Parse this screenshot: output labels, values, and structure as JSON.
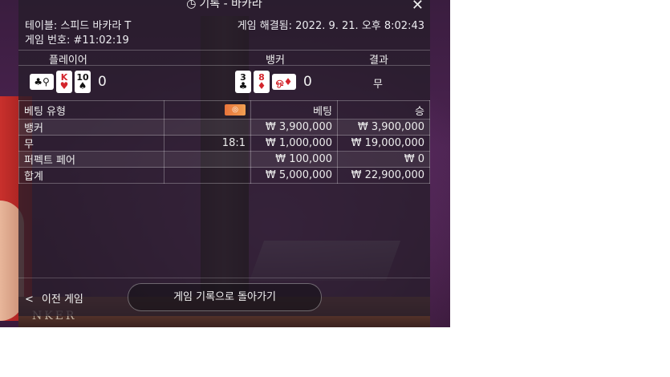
{
  "header": {
    "title": "기록 - 바카라",
    "title_icon": "history-icon",
    "close_icon": "close-icon"
  },
  "game_info": {
    "table": "테이블: 스피드 바카라 T",
    "game_number": "게임 번호: #11:02:19",
    "resolved": "게임 해결됨: 2022. 9. 21. 오후 8:02:43"
  },
  "result_headers": {
    "player": "플레이어",
    "banker": "뱅커",
    "result": "결과"
  },
  "player_hand": {
    "cards": [
      {
        "rank": "♣",
        "suit": "♣",
        "side": true,
        "color": "#111111",
        "glyph2": "⚲"
      },
      {
        "rank": "K",
        "suit": "♥",
        "color": "#d3252c"
      },
      {
        "rank": "10",
        "suit": "♠",
        "color": "#111111"
      }
    ],
    "score": "0"
  },
  "banker_hand": {
    "cards": [
      {
        "rank": "3",
        "suit": "♣",
        "color": "#111111"
      },
      {
        "rank": "8",
        "suit": "♦",
        "color": "#d3252c"
      },
      {
        "rank": "♦",
        "suit": "♦",
        "side": true,
        "color": "#d3252c"
      }
    ],
    "score": "0"
  },
  "result_value": "무",
  "bets_table": {
    "columns": [
      "베팅 유형",
      "",
      "베팅",
      "승"
    ],
    "chip_icon": "chip-icon",
    "rows": [
      {
        "type": "뱅커",
        "odds": "",
        "bet": "₩ 3,900,000",
        "win": "₩ 3,900,000"
      },
      {
        "type": "무",
        "odds": "18:1",
        "bet": "₩ 1,000,000",
        "win": "₩ 19,000,000"
      },
      {
        "type": "퍼펙트 페어",
        "odds": "",
        "bet": "₩ 100,000",
        "win": "₩ 0"
      },
      {
        "type": "합계",
        "odds": "",
        "bet": "₩ 5,000,000",
        "win": "₩ 22,900,000"
      }
    ]
  },
  "footer": {
    "prev_label": "이전 게임",
    "back_label": "게임 기록으로 돌아가기"
  },
  "background": {
    "table_text": "NKER"
  },
  "colors": {
    "red_suit": "#d3252c",
    "panel": "#261e2a"
  }
}
